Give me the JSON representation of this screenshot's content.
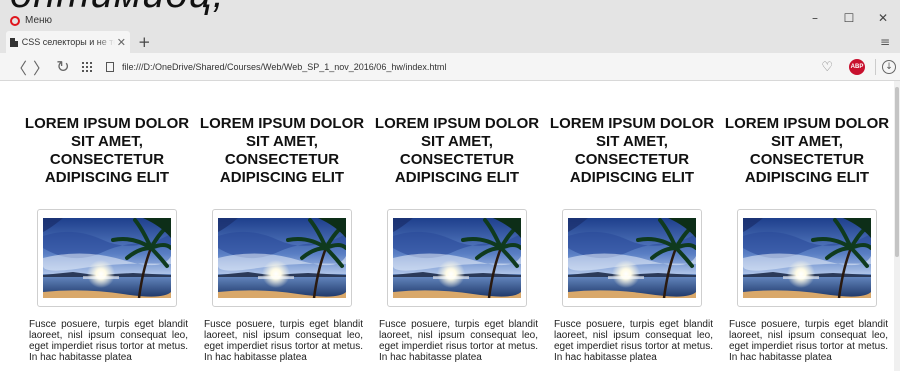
{
  "overlay_fragment": "оптимиоц,",
  "window": {
    "menu_label": "Меню",
    "controls": [
      "–",
      "☐",
      "✕"
    ]
  },
  "tabs": [
    {
      "label": "CSS селекторы и не тольк",
      "close": "✕"
    }
  ],
  "new_tab": "+",
  "tab_menu": "≡",
  "address_bar": {
    "url": "file:///D:/OneDrive/Shared/Courses/Web/Web_SP_1_nov_2016/06_hw/index.html",
    "adblock_label": "ABP"
  },
  "nav": {
    "back": "〈",
    "forward": "〉",
    "reload": "↻"
  },
  "cards": [
    {
      "title": "LOREM IPSUM DOLOR SIT AMET, CONSECTETUR ADIPISCING ELIT",
      "text": "Fusce posuere, turpis eget blandit laoreet, nisl ipsum consequat leo, eget imperdiet risus tortor at metus. In hac habitasse platea"
    },
    {
      "title": "LOREM IPSUM DOLOR SIT AMET, CONSECTETUR ADIPISCING ELIT",
      "text": "Fusce posuere, turpis eget blandit laoreet, nisl ipsum consequat leo, eget imperdiet risus tortor at metus. In hac habitasse platea"
    },
    {
      "title": "LOREM IPSUM DOLOR SIT AMET, CONSECTETUR ADIPISCING ELIT",
      "text": "Fusce posuere, turpis eget blandit laoreet, nisl ipsum consequat leo, eget imperdiet risus tortor at metus. In hac habitasse platea"
    },
    {
      "title": "LOREM IPSUM DOLOR SIT AMET, CONSECTETUR ADIPISCING ELIT",
      "text": "Fusce posuere, turpis eget blandit laoreet, nisl ipsum consequat leo, eget imperdiet risus tortor at metus. In hac habitasse platea"
    },
    {
      "title": "LOREM IPSUM DOLOR SIT AMET, CONSECTETUR ADIPISCING ELIT",
      "text": "Fusce posuere, turpis eget blandit laoreet, nisl ipsum consequat leo, eget imperdiet risus tortor at metus. In hac habitasse platea"
    }
  ],
  "colors": {
    "chrome_bg": "#e4e4e4",
    "opera_red": "#e0151d",
    "abp_red": "#c8102e"
  }
}
